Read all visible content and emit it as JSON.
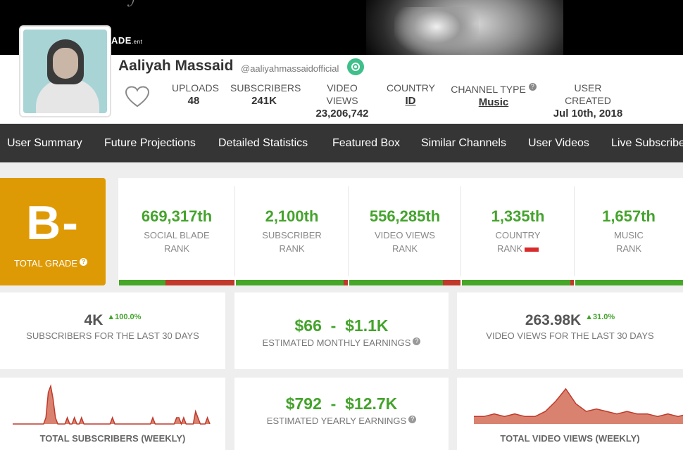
{
  "banner": {
    "logo_text": "ADE",
    "logo_suffix": ".ent"
  },
  "channel": {
    "name": "Aaliyah Massaid",
    "handle": "@aaliyahmassaidofficial"
  },
  "stats": [
    {
      "label": "UPLOADS",
      "value": "48"
    },
    {
      "label": "SUBSCRIBERS",
      "value": "241K"
    },
    {
      "label": "VIDEO VIEWS",
      "value": "23,206,742"
    },
    {
      "label": "COUNTRY",
      "value": "ID"
    },
    {
      "label": "CHANNEL TYPE",
      "value": "Music",
      "help": "?"
    },
    {
      "label": "USER CREATED",
      "value": "Jul 10th, 2018"
    }
  ],
  "nav": {
    "tabs": [
      "User Summary",
      "Future Projections",
      "Detailed Statistics",
      "Featured Box",
      "Similar Channels",
      "User Videos",
      "Live Subscriber Count"
    ]
  },
  "grade": {
    "letter": "B-",
    "label": "TOTAL GRADE",
    "help": "?"
  },
  "ranks": [
    {
      "value": "669,317th",
      "line1": "SOCIAL BLADE",
      "line2": "RANK",
      "green_pct": 40
    },
    {
      "value": "2,100th",
      "line1": "SUBSCRIBER",
      "line2": "RANK",
      "green_pct": 96
    },
    {
      "value": "556,285th",
      "line1": "VIDEO VIEWS",
      "line2": "RANK",
      "green_pct": 84
    },
    {
      "value": "1,335th",
      "line1": "COUNTRY",
      "line2": "RANK",
      "green_pct": 97
    },
    {
      "value": "1,657th",
      "line1": "MUSIC",
      "line2": "RANK",
      "green_pct": 96
    }
  ],
  "cards": {
    "subs30": {
      "value": "4K",
      "change": "100.0%",
      "label": "SUBSCRIBERS FOR THE LAST 30 DAYS"
    },
    "monthly": {
      "low": "$66",
      "sep": "-",
      "high": "$1.1K",
      "label": "ESTIMATED MONTHLY EARNINGS",
      "help": "?"
    },
    "views30": {
      "value": "263.98K",
      "change": "31.0%",
      "label": "VIDEO VIEWS FOR THE LAST 30 DAYS"
    },
    "subs_weekly": {
      "label": "TOTAL SUBSCRIBERS (WEEKLY)"
    },
    "yearly": {
      "low": "$792",
      "sep": "-",
      "high": "$12.7K",
      "label": "ESTIMATED YEARLY EARNINGS",
      "help": "?"
    },
    "views_weekly": {
      "label": "TOTAL VIDEO VIEWS (WEEKLY)"
    }
  },
  "colors": {
    "accent_green": "#44a32c",
    "grade_orange": "#de9a05",
    "nav_bg": "#353535",
    "spark_fill": "#d9826f",
    "spark_stroke": "#c0392b"
  },
  "chart_data": [
    {
      "type": "area",
      "values": [
        0,
        0,
        0,
        0,
        0,
        0,
        0,
        0,
        0,
        0,
        0,
        0,
        0,
        0,
        1,
        5,
        6,
        4,
        1,
        0,
        0,
        0,
        0,
        1,
        0,
        0,
        1,
        0,
        0,
        1,
        0,
        0,
        0,
        0,
        0,
        0,
        0,
        0,
        0,
        0,
        0,
        0,
        1,
        0,
        0,
        0,
        0,
        0,
        0,
        0,
        0,
        0,
        0,
        0,
        0,
        0,
        0,
        0,
        0,
        1,
        0,
        0,
        0,
        0,
        0,
        0,
        0,
        0,
        0,
        1,
        1,
        0,
        1,
        0,
        0,
        0,
        0,
        2,
        1,
        0,
        0,
        0,
        1,
        0
      ]
    },
    {
      "type": "area",
      "values": [
        3,
        3,
        4,
        3,
        4,
        3,
        3,
        5,
        9,
        14,
        8,
        5,
        6,
        5,
        4,
        5,
        4,
        4,
        3,
        4,
        3,
        4,
        4,
        3,
        3,
        3,
        4,
        3,
        3,
        3,
        3,
        3,
        3,
        3,
        3,
        4,
        3,
        3,
        3,
        3,
        3,
        3,
        3,
        3,
        3,
        3,
        3,
        3,
        3,
        3,
        3,
        3,
        3,
        4,
        5,
        6,
        5,
        4,
        4,
        3,
        4,
        8,
        5,
        3,
        3
      ]
    }
  ]
}
